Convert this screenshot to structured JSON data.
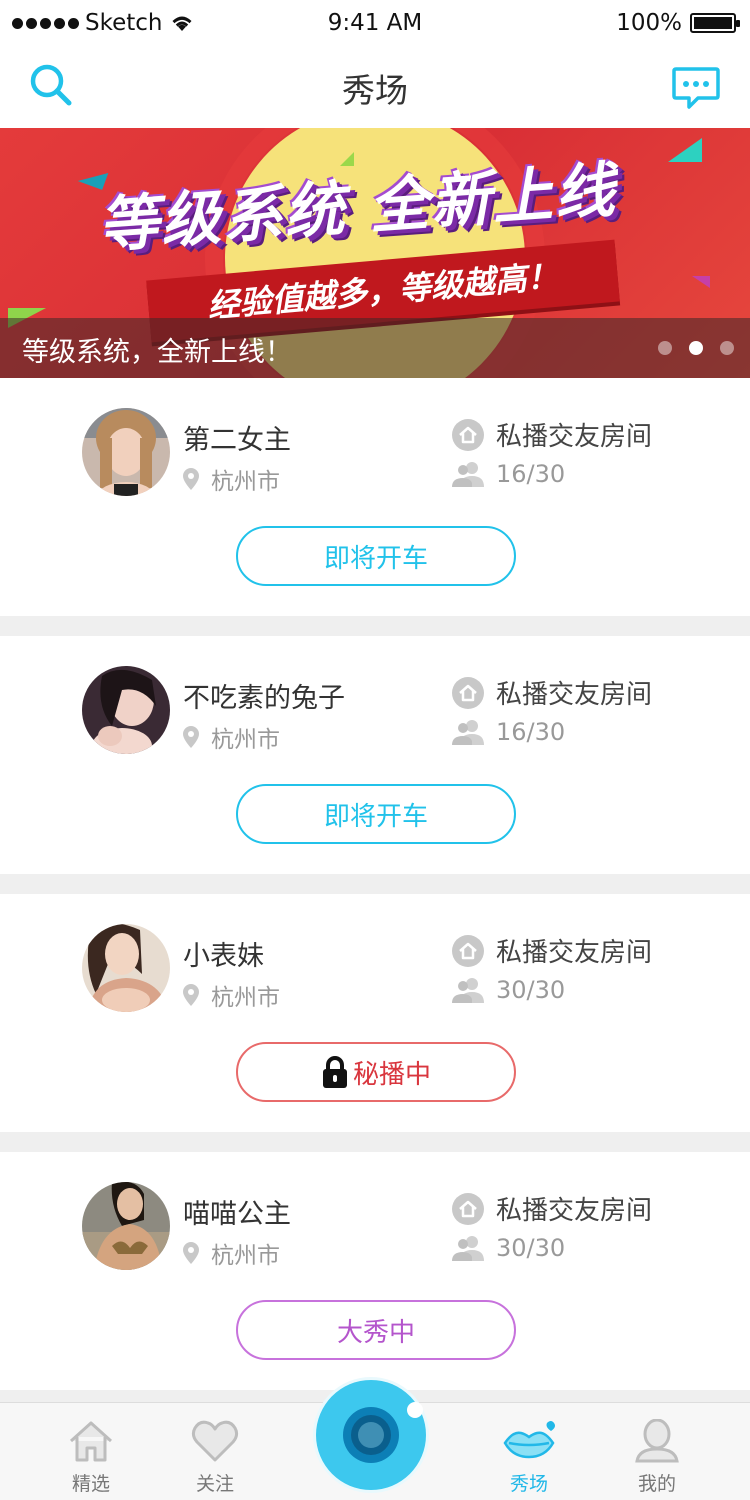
{
  "status_bar": {
    "carrier": "Sketch",
    "time": "9:41 AM",
    "battery": "100%"
  },
  "nav": {
    "title": "秀场"
  },
  "banner": {
    "headline": "等级系统 全新上线",
    "subline": "经验值越多，等级越高！",
    "caption": "等级系统，全新上线！",
    "pages": 3,
    "active_page": 2
  },
  "rooms": [
    {
      "host": "第二女主",
      "location": "杭州市",
      "room_type": "私播交友房间",
      "occupancy": "16/30",
      "action": "即将开车",
      "action_style": "blue"
    },
    {
      "host": "不吃素的兔子",
      "location": "杭州市",
      "room_type": "私播交友房间",
      "occupancy": "16/30",
      "action": "即将开车",
      "action_style": "blue"
    },
    {
      "host": "小表妹",
      "location": "杭州市",
      "room_type": "私播交友房间",
      "occupancy": "30/30",
      "action": "秘播中",
      "action_style": "red"
    },
    {
      "host": "喵喵公主",
      "location": "杭州市",
      "room_type": "私播交友房间",
      "occupancy": "30/30",
      "action": "大秀中",
      "action_style": "purple"
    }
  ],
  "tabs": [
    {
      "label": "精选",
      "icon": "home-icon"
    },
    {
      "label": "关注",
      "icon": "heart-icon"
    },
    {
      "label": "秀场",
      "icon": "lips-icon",
      "active": true
    },
    {
      "label": "我的",
      "icon": "user-icon"
    }
  ],
  "colors": {
    "accent": "#21c2ea",
    "banner_red": "#e43b3b",
    "secret_red": "#d9363e",
    "show_purple": "#b455cc"
  }
}
